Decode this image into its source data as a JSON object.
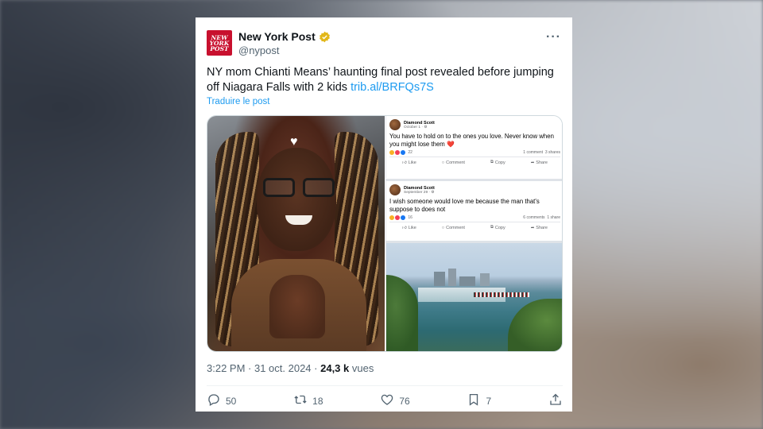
{
  "tweet": {
    "display_name": "New York Post",
    "handle": "@nypost",
    "logo_text": "NEW YORK POST",
    "text_main": "NY mom Chianti Means’ haunting final post revealed before jumping off Niagara Falls with 2 kids ",
    "link": "trib.al/BRFQs7S",
    "translate": "Traduire le post",
    "time": "3:22 PM",
    "date": "31 oct. 2024",
    "views_count": "24,3 k",
    "views_label": "vues",
    "more": "···"
  },
  "media": {
    "fb_posts": [
      {
        "name": "Diamond Scott",
        "date": "October 1 · ",
        "text": "You have to hold on to the ones you love. Never know when you might lose them ❤️",
        "reactions": "22",
        "comments": "1 comment",
        "shares": "3 shares",
        "like": "Like",
        "comment": "Comment",
        "copy": "Copy",
        "share": "Share"
      },
      {
        "name": "Diamond Scott",
        "date": "September 29 · ",
        "text": "I wish someone would love me because the man that's suppose to does not",
        "reactions": "16",
        "comments": "6 comments",
        "shares": "1 share",
        "like": "Like",
        "comment": "Comment",
        "copy": "Copy",
        "share": "Share"
      }
    ]
  },
  "actions": {
    "replies": "50",
    "reposts": "18",
    "likes": "76",
    "bookmarks": "7"
  },
  "colors": {
    "link": "#1d9bf0",
    "brand": "#c8102e",
    "muted": "#536471"
  }
}
